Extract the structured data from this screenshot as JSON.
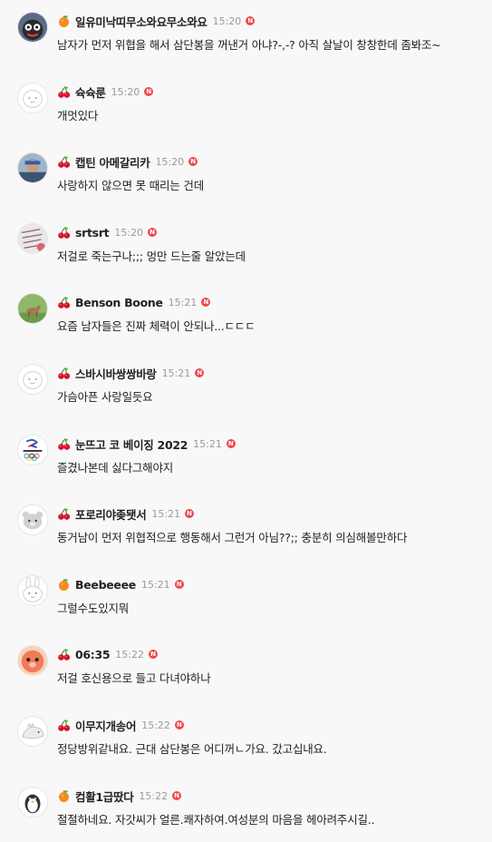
{
  "colors": {
    "background": "#f8f8f8",
    "new_badge": "#f0484b",
    "time_text": "#9a9a9a"
  },
  "icons": {
    "orange_badge": "orange-fruit-icon",
    "cherry_badge": "cherry-icon",
    "new_indicator": "N"
  },
  "messages": [
    {
      "badge": "orange",
      "avatar": "cartoon-character",
      "nickname": "일유미낙띠무소와요무소와요",
      "time": "15:20",
      "new": "N",
      "text": "남자가 먼저 위협을 해서 삼단봉을 꺼낸거 아냐?-,-? 아직 살날이 창창한데 좀봐조~"
    },
    {
      "badge": "cherry",
      "avatar": "default-face",
      "nickname": "슉슉룬",
      "time": "15:20",
      "new": "N",
      "text": "개멋있다"
    },
    {
      "badge": "cherry",
      "avatar": "person-photo",
      "nickname": "캡틴 아메갈리카",
      "time": "15:20",
      "new": "N",
      "text": "사랑하지 않으면 못 때리는 건데"
    },
    {
      "badge": "cherry",
      "avatar": "handwriting-photo",
      "nickname": "srtsrt",
      "time": "15:20",
      "new": "N",
      "text": "저걸로 죽는구나;;; 멍만 드는줄 알았는데"
    },
    {
      "badge": "cherry",
      "avatar": "animal-field-photo",
      "nickname": "Benson Boone",
      "time": "15:21",
      "new": "N",
      "text": "요즘 남자들은 진짜 체력이 안되나...ㄷㄷㄷ"
    },
    {
      "badge": "cherry",
      "avatar": "default-face",
      "nickname": "스바시바쌍쌍바랑",
      "time": "15:21",
      "new": "N",
      "text": "가슴아픈 사랑일듯요"
    },
    {
      "badge": "cherry",
      "avatar": "olympic-logo",
      "avatar_caption": "BEIJING 2022",
      "nickname": "눈뜨고 코 베이징 2022",
      "time": "15:21",
      "new": "N",
      "text": "즐겼나본데 싫다그해야지"
    },
    {
      "badge": "cherry",
      "avatar": "bear-character",
      "nickname": "포로리야좆됏서",
      "time": "15:21",
      "new": "N",
      "text": "동거남이 먼저 위협적으로 행동해서 그런거 아님??;; 충분히 의심해볼만하다"
    },
    {
      "badge": "orange",
      "avatar": "bunny-character",
      "nickname": "Beebeeee",
      "time": "15:21",
      "new": "N",
      "text": "그럴수도있지뭐"
    },
    {
      "badge": "cherry",
      "avatar": "pink-character",
      "nickname": "06:35",
      "time": "15:22",
      "new": "N",
      "text": "저걸 호신용으로 들고 다녀야하나"
    },
    {
      "badge": "cherry",
      "avatar": "dinosaur-character",
      "nickname": "이무지개송어",
      "time": "15:22",
      "new": "N",
      "text": "정당방위같내요. 근대 삼단봉은 어디꺼ㄴ가요. 갔고십내요."
    },
    {
      "badge": "orange",
      "avatar": "penguin-character",
      "nickname": "컴활1급땄다",
      "time": "15:22",
      "new": "N",
      "text": "절절하네요. 자갓씨가 얼른.쾌자하여.여성분의 마음을 헤아려주시길.."
    }
  ]
}
